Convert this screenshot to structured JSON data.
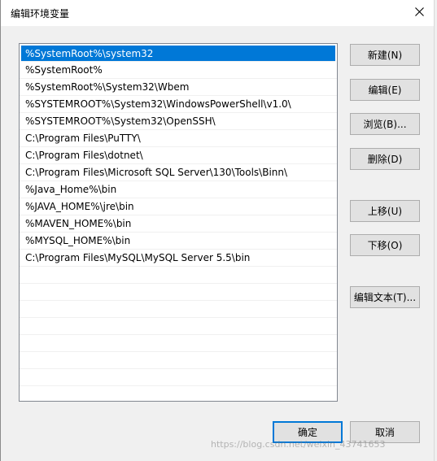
{
  "dialog": {
    "title": "编辑环境变量",
    "close_icon": "close-icon"
  },
  "list": {
    "items": [
      "%SystemRoot%\\system32",
      "%SystemRoot%",
      "%SystemRoot%\\System32\\Wbem",
      "%SYSTEMROOT%\\System32\\WindowsPowerShell\\v1.0\\",
      "%SYSTEMROOT%\\System32\\OpenSSH\\",
      "C:\\Program Files\\PuTTY\\",
      "C:\\Program Files\\dotnet\\",
      "C:\\Program Files\\Microsoft SQL Server\\130\\Tools\\Binn\\",
      "%Java_Home%\\bin",
      "%JAVA_HOME%\\jre\\bin",
      "%MAVEN_HOME%\\bin",
      "%MYSQL_HOME%\\bin",
      "C:\\Program Files\\MySQL\\MySQL Server 5.5\\bin"
    ],
    "selected_index": 0
  },
  "buttons": {
    "new": "新建(N)",
    "edit": "编辑(E)",
    "browse": "浏览(B)...",
    "delete": "删除(D)",
    "move_up": "上移(U)",
    "move_down": "下移(O)",
    "edit_text": "编辑文本(T)...",
    "ok": "确定",
    "cancel": "取消"
  },
  "watermark": "https://blog.csdn.net/weixin_43741653",
  "colors": {
    "selection": "#0078d7",
    "button_face": "#e1e1e1",
    "dialog_bg": "#f0f0f0"
  }
}
